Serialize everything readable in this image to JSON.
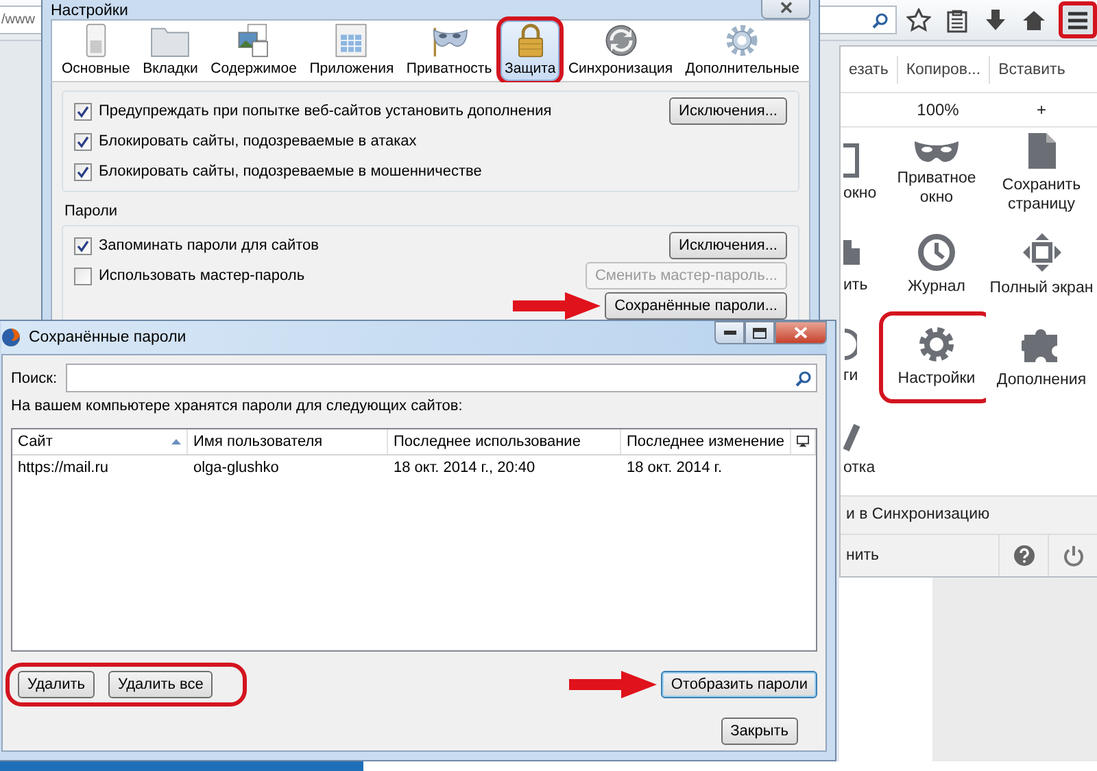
{
  "browser": {
    "address": "/www",
    "menu_button": {
      "circled": true
    }
  },
  "menu": {
    "edit": [
      "езать",
      "Копиров...",
      "Вставить"
    ],
    "zoom_level": "100%",
    "zoom_in": "+",
    "items": [
      {
        "label": "окно",
        "circled": false
      },
      {
        "label": "Приватное окно",
        "circled": false
      },
      {
        "label": "Сохранить страницу",
        "circled": false
      },
      {
        "label": "ить",
        "circled": false
      },
      {
        "label": "Журнал",
        "circled": false
      },
      {
        "label": "Полный экран",
        "circled": false
      },
      {
        "label": "ги",
        "circled": false
      },
      {
        "label": "Настройки",
        "circled": true
      },
      {
        "label": "Дополнения",
        "circled": false
      },
      {
        "label": "отка",
        "circled": false
      }
    ],
    "sync": "и в Синхронизацию",
    "footer": "нить"
  },
  "settings": {
    "title": "Настройки",
    "tabs": [
      {
        "label": "Основные",
        "selected": false,
        "circled": false
      },
      {
        "label": "Вкладки",
        "selected": false,
        "circled": false
      },
      {
        "label": "Содержимое",
        "selected": false,
        "circled": false
      },
      {
        "label": "Приложения",
        "selected": false,
        "circled": false
      },
      {
        "label": "Приватность",
        "selected": false,
        "circled": false
      },
      {
        "label": "Защита",
        "selected": true,
        "circled": true
      },
      {
        "label": "Синхронизация",
        "selected": false,
        "circled": false
      },
      {
        "label": "Дополнительные",
        "selected": false,
        "circled": false
      }
    ],
    "security": {
      "checks": [
        {
          "label": "Предупреждать при попытке веб-сайтов установить дополнения",
          "checked": true
        },
        {
          "label": "Блокировать сайты, подозреваемые в атаках",
          "checked": true
        },
        {
          "label": "Блокировать сайты, подозреваемые в мошенничестве",
          "checked": true
        }
      ],
      "buttons": [
        {
          "label": "Исключения...",
          "disabled": false,
          "arrow": false
        }
      ]
    },
    "passwords": {
      "title": "Пароли",
      "checks": [
        {
          "label": "Запоминать пароли для сайтов",
          "checked": true
        },
        {
          "label": "Использовать мастер-пароль",
          "checked": false
        }
      ],
      "buttons": [
        {
          "label": "Исключения...",
          "disabled": false,
          "arrow": false
        },
        {
          "label": "Сменить мастер-пароль...",
          "disabled": true,
          "arrow": false
        },
        {
          "label": "Сохранённые пароли...",
          "disabled": false,
          "arrow": true
        }
      ]
    }
  },
  "dialog": {
    "title": "Сохранённые пароли",
    "search_label": "Поиск:",
    "caption": "На вашем компьютере хранятся пароли для следующих сайтов:",
    "columns": [
      {
        "label": "Сайт",
        "sorted": true
      },
      {
        "label": "Имя пользователя",
        "sorted": false
      },
      {
        "label": "Последнее использование",
        "sorted": false
      },
      {
        "label": "Последнее изменение",
        "sorted": false
      }
    ],
    "rows": [
      [
        "https://mail.ru",
        "olga-glushko",
        "18 окт. 2014 г., 20:40",
        "18 окт. 2014 г."
      ]
    ],
    "left_buttons_circled": true,
    "left_buttons": [
      {
        "label": "Удалить",
        "focused": false,
        "arrow": false
      },
      {
        "label": "Удалить все",
        "focused": false,
        "arrow": false
      }
    ],
    "show_button": {
      "label": "Отобразить пароли",
      "focused": true,
      "arrow": true
    },
    "close_button": {
      "label": "Закрыть",
      "focused": false
    }
  }
}
